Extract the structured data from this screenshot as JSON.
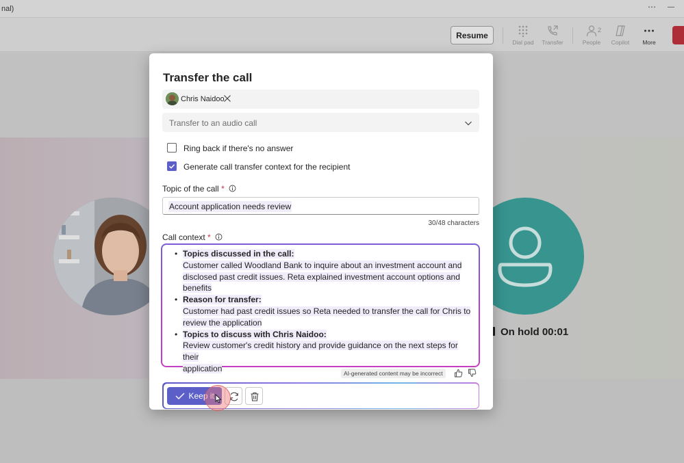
{
  "window": {
    "title_fragment": "nal)",
    "more_glyph": "⋯",
    "minimize_glyph": "—"
  },
  "toolbar": {
    "resume_label": "Resume",
    "dial_pad_label": "Dial pad",
    "transfer_label": "Transfer",
    "people_label": "People",
    "people_count": "2",
    "copilot_label": "Copilot",
    "more_label": "More"
  },
  "call": {
    "hold_status": "On hold 00:01"
  },
  "modal": {
    "title": "Transfer the call",
    "recipient_name": "Chris Naidoo",
    "transfer_type": "Transfer to an audio call",
    "ring_back_label": "Ring back if there's no answer",
    "ring_back_checked": false,
    "generate_context_label": "Generate call transfer context for the recipient",
    "generate_context_checked": true,
    "topic_label": "Topic of the call",
    "topic_value": "Account application needs review",
    "char_counter": "30/48 characters",
    "context_label": "Call context",
    "required_mark": "*",
    "bullet_glyph": "•",
    "context_items": [
      {
        "heading": "Topics discussed in the call:",
        "lines": [
          "Customer called Woodland Bank to inquire about an investment account and",
          "disclosed past credit issues. Reta explained investment account options and",
          "benefits"
        ]
      },
      {
        "heading": "Reason for transfer:",
        "lines": [
          "Customer had past credit issues so Reta needed to transfer the call for Chris to",
          "review the application"
        ]
      },
      {
        "heading": "Topics to discuss with Chris Naidoo:",
        "lines": [
          "Review customer's credit history and provide guidance on the next steps for their",
          "application"
        ]
      }
    ],
    "ai_note": "AI-generated content may be incorrect",
    "keep_label": "Keep it"
  },
  "colors": {
    "accent": "#5b5fc7",
    "end_call": "#b5303a",
    "avatar_teal": "#3a9b95",
    "required": "#c4314b"
  }
}
